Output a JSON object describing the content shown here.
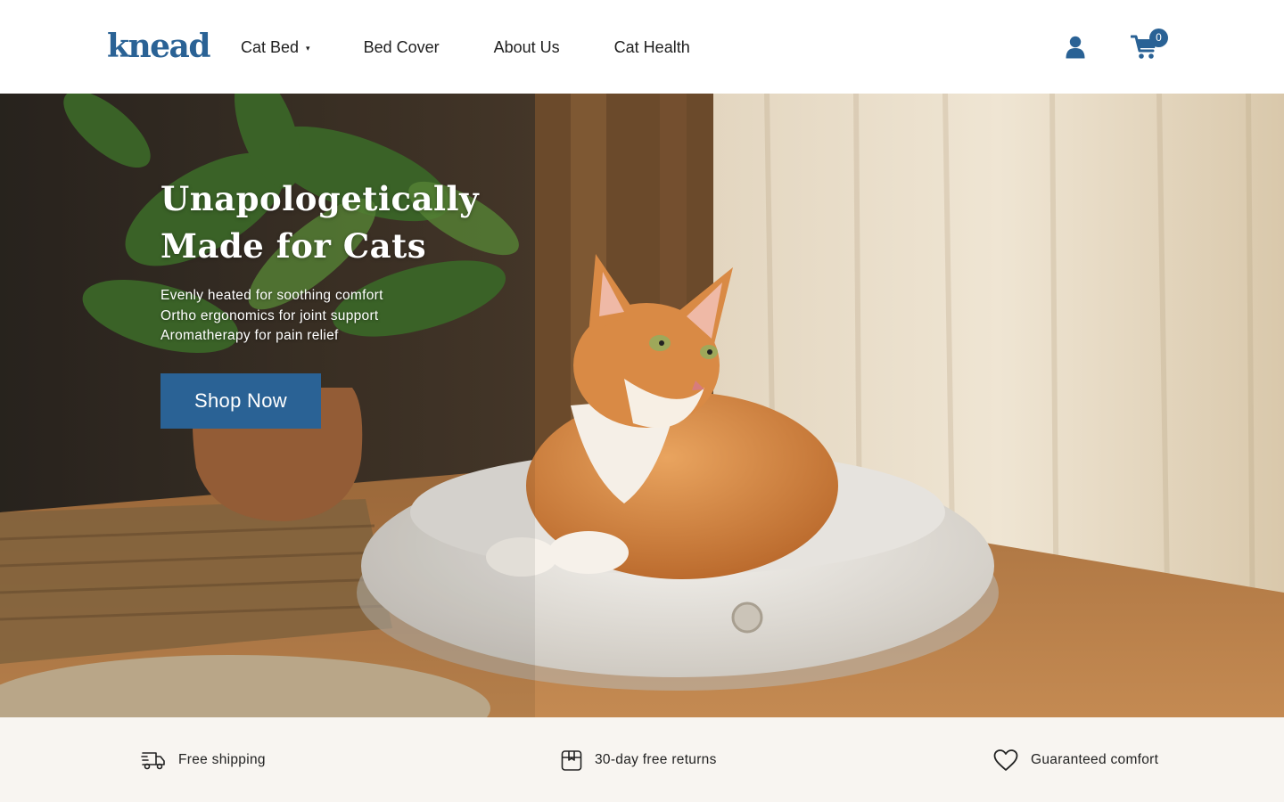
{
  "brand": {
    "logo_text": "knead",
    "accent_color": "#2a6295"
  },
  "nav": {
    "items": [
      {
        "label": "Cat Bed",
        "has_dropdown": true
      },
      {
        "label": "Bed Cover",
        "has_dropdown": false
      },
      {
        "label": "About Us",
        "has_dropdown": false
      },
      {
        "label": "Cat Health",
        "has_dropdown": false
      }
    ],
    "dropdown_caret": "▾",
    "account_icon": "user-icon",
    "cart_icon": "cart-icon",
    "cart_count": "0"
  },
  "hero": {
    "title_line1": "Unapologetically",
    "title_line2": "Made for Cats",
    "features": [
      "Evenly heated for soothing comfort",
      "Ortho ergonomics for joint support",
      "Aromatherapy for pain relief"
    ],
    "cta_label": "Shop Now"
  },
  "perks": [
    {
      "icon": "delivery-truck-icon",
      "label": "Free shipping"
    },
    {
      "icon": "return-box-icon",
      "label": "30-day free returns"
    },
    {
      "icon": "heart-icon",
      "label": "Guaranteed comfort"
    }
  ],
  "colors": {
    "perks_background": "#f8f5f1",
    "button": "#2a6295"
  }
}
